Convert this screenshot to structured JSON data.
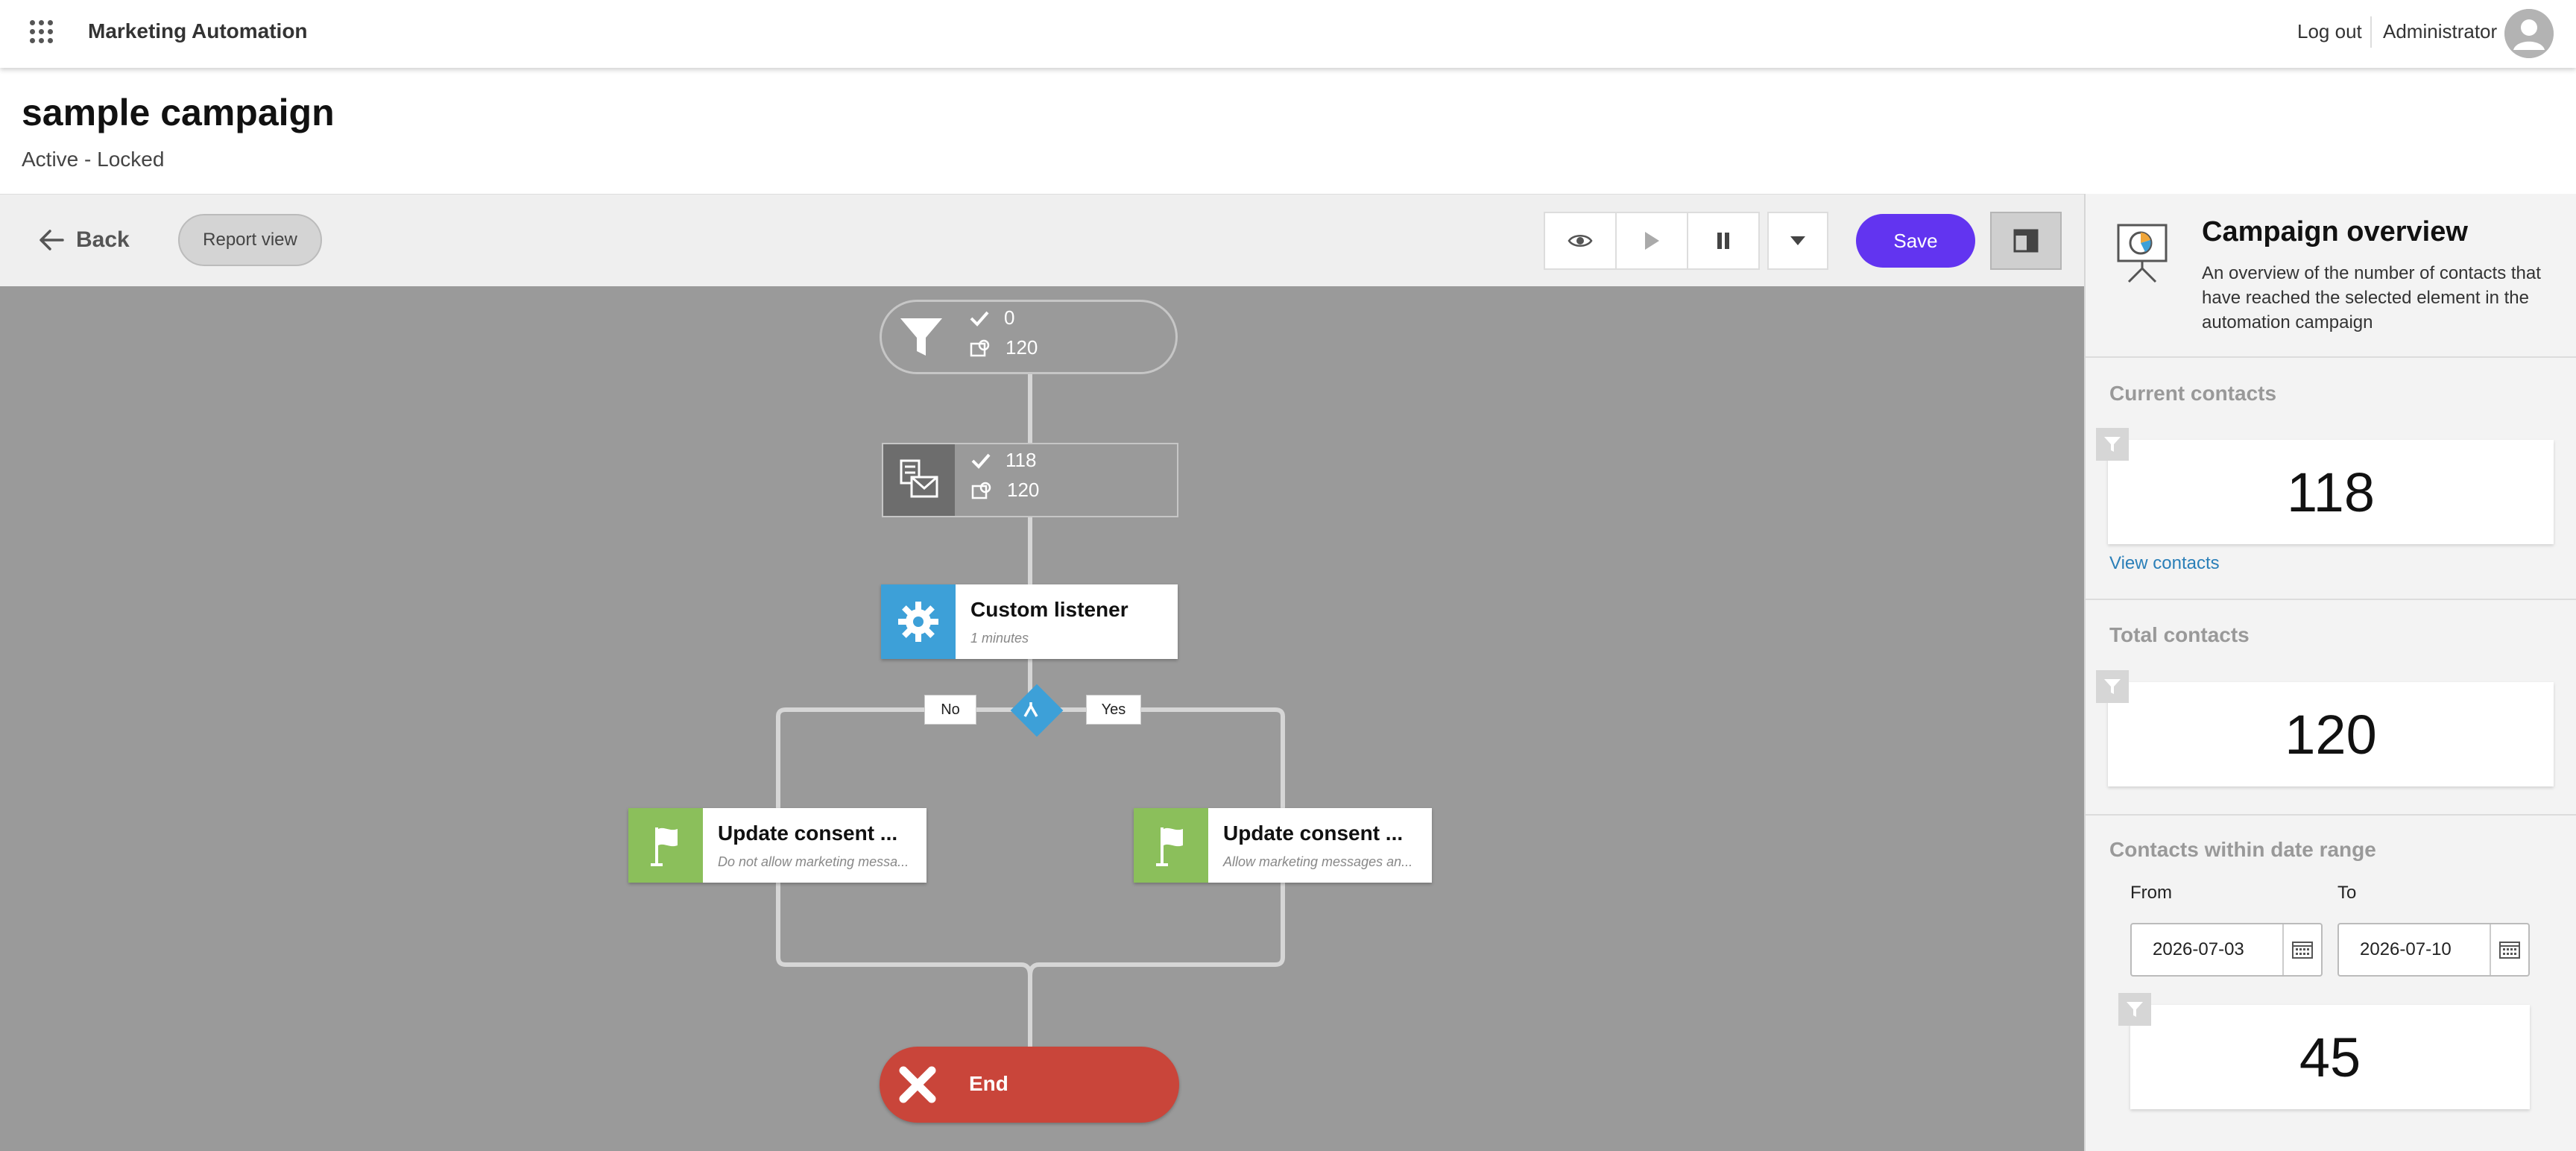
{
  "app": {
    "title": "Marketing Automation",
    "logout": "Log out",
    "user": "Administrator"
  },
  "campaign": {
    "title": "sample campaign",
    "status": "Active - Locked"
  },
  "toolbar": {
    "back": "Back",
    "report_view": "Report view",
    "save": "Save"
  },
  "flow": {
    "entry": {
      "completed": "0",
      "total": "120"
    },
    "email": {
      "completed": "118",
      "total": "120"
    },
    "listener": {
      "title": "Custom listener",
      "subtitle": "1 minutes"
    },
    "branch_no": "No",
    "branch_yes": "Yes",
    "consent_left": {
      "title": "Update consent ...",
      "subtitle": "Do not allow marketing messa..."
    },
    "consent_right": {
      "title": "Update consent ...",
      "subtitle": "Allow marketing messages an..."
    },
    "end": "End"
  },
  "overview": {
    "title": "Campaign overview",
    "description": "An overview of the number of contacts that have reached the selected element in the automation campaign",
    "current": {
      "title": "Current contacts",
      "value": "118",
      "link": "View contacts"
    },
    "total": {
      "title": "Total contacts",
      "value": "120"
    },
    "range": {
      "title": "Contacts within date range",
      "from_label": "From",
      "to_label": "To",
      "from": "2026-07-03",
      "to": "2026-07-10",
      "value": "45"
    }
  },
  "colors": {
    "accent": "#6234f0",
    "listener": "#3da0d8",
    "action": "#8bbf5b",
    "end": "#c9453a",
    "canvas": "#9a9a9a",
    "link": "#2a7fb8"
  }
}
